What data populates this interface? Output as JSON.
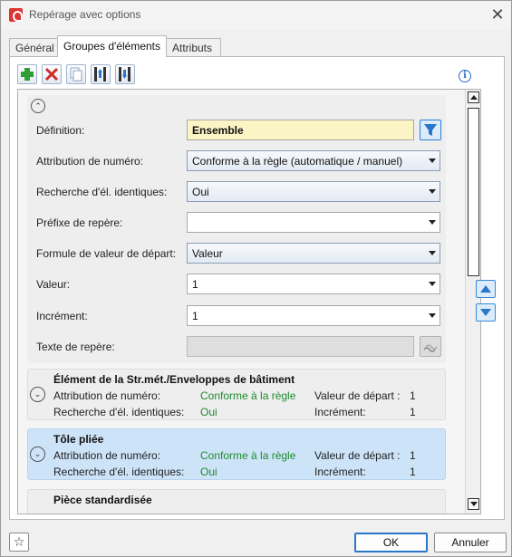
{
  "window": {
    "title": "Repérage avec options",
    "close_glyph": "✕"
  },
  "tabs": [
    {
      "label": "Général"
    },
    {
      "label": "Groupes d'éléments"
    },
    {
      "label": "Attributs"
    }
  ],
  "toolbar": {
    "icons": [
      "add-icon",
      "delete-icon",
      "copy-icon",
      "move-up-list-icon",
      "move-down-list-icon"
    ],
    "info_glyph": "i"
  },
  "definition_panel": {
    "collapse_glyph": "⌃",
    "rows": [
      {
        "label": "Définition:",
        "value": "Ensemble"
      },
      {
        "label": "Attribution de numéro:",
        "value": "Conforme à la règle (automatique / manuel)"
      },
      {
        "label": "Recherche d'él. identiques:",
        "value": "Oui"
      },
      {
        "label": "Préfixe de repère:",
        "value": ""
      },
      {
        "label": "Formule de valeur de départ:",
        "value": "Valeur"
      },
      {
        "label": "Valeur:",
        "value": "1"
      },
      {
        "label": "Incrément:",
        "value": "1"
      },
      {
        "label": "Texte de repère:",
        "value": ""
      }
    ]
  },
  "groups": [
    {
      "title": "Élément de la Str.mét./Enveloppes de bâtiment",
      "toggle_glyph": "⌄",
      "numbering_label": "Attribution de numéro:",
      "numbering_value": "Conforme à la règle",
      "search_label": "Recherche d'él. identiques:",
      "search_value": "Oui",
      "start_label": "Valeur de départ :",
      "start_value": "1",
      "increment_label": "Incrément:",
      "increment_value": "1"
    },
    {
      "title": "Tôle pliée",
      "toggle_glyph": "⌄",
      "numbering_label": "Attribution de numéro:",
      "numbering_value": "Conforme à la règle",
      "search_label": "Recherche d'él. identiques:",
      "search_value": "Oui",
      "start_label": "Valeur de départ :",
      "start_value": "1",
      "increment_label": "Incrément:",
      "increment_value": "1"
    },
    {
      "title": "Pièce standardisée"
    }
  ],
  "footer": {
    "favorite_glyph": "☆",
    "ok_label": "OK",
    "cancel_label": "Annuler"
  }
}
